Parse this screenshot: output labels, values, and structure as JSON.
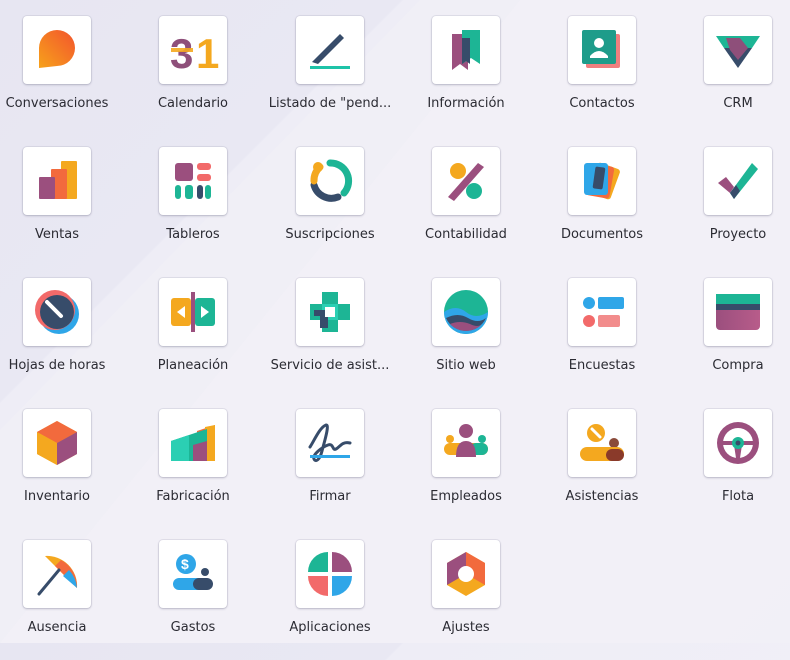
{
  "apps": [
    {
      "name": "Conversaciones",
      "icon": "chat-bubble-icon"
    },
    {
      "name": "Calendario",
      "icon": "calendar-31-icon"
    },
    {
      "name": "Listado de \"pend...",
      "icon": "pencil-line-icon"
    },
    {
      "name": "Información",
      "icon": "bookmark-book-icon"
    },
    {
      "name": "Contactos",
      "icon": "contact-card-icon"
    },
    {
      "name": "CRM",
      "icon": "handshake-icon"
    },
    {
      "name": "Ventas",
      "icon": "bar-chart-icon"
    },
    {
      "name": "Tableros",
      "icon": "dashboard-blocks-icon"
    },
    {
      "name": "Suscripciones",
      "icon": "cycle-arrows-icon"
    },
    {
      "name": "Contabilidad",
      "icon": "percent-icon"
    },
    {
      "name": "Documentos",
      "icon": "stacked-cards-icon"
    },
    {
      "name": "Proyecto",
      "icon": "checkmark-icon"
    },
    {
      "name": "Hojas de horas",
      "icon": "stopwatch-icon"
    },
    {
      "name": "Planeación",
      "icon": "planning-arrows-icon"
    },
    {
      "name": "Servicio de asist...",
      "icon": "helpdesk-cross-icon"
    },
    {
      "name": "Sitio web",
      "icon": "globe-waves-icon"
    },
    {
      "name": "Encuestas",
      "icon": "survey-bars-icon"
    },
    {
      "name": "Compra",
      "icon": "credit-card-icon"
    },
    {
      "name": "Inventario",
      "icon": "cube-box-icon"
    },
    {
      "name": "Fabricación",
      "icon": "factory-icon"
    },
    {
      "name": "Firmar",
      "icon": "signature-icon"
    },
    {
      "name": "Empleados",
      "icon": "people-group-icon"
    },
    {
      "name": "Asistencias",
      "icon": "attendance-icon"
    },
    {
      "name": "Flota",
      "icon": "steering-wheel-icon"
    },
    {
      "name": "Ausencia",
      "icon": "beach-umbrella-icon"
    },
    {
      "name": "Gastos",
      "icon": "dollar-expense-icon"
    },
    {
      "name": "Aplicaciones",
      "icon": "app-quadrants-icon"
    },
    {
      "name": "Ajustes",
      "icon": "gear-hexagon-icon"
    }
  ]
}
